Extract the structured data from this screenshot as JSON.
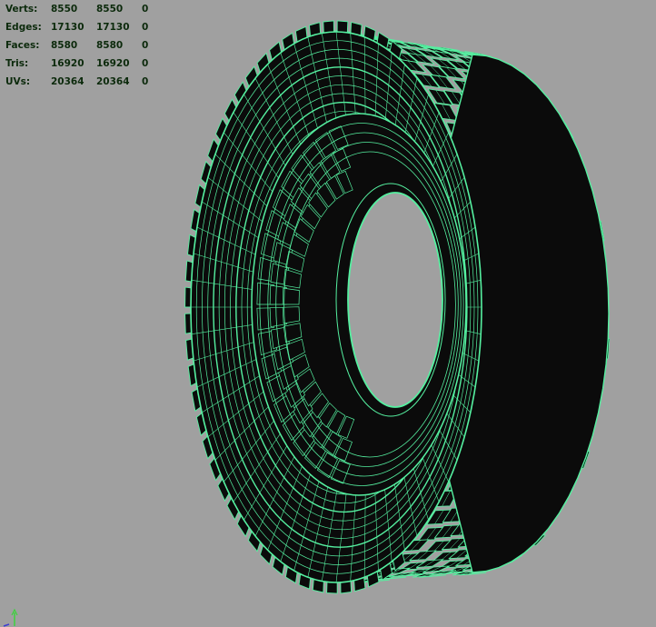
{
  "hud": {
    "rows": [
      {
        "label": "Verts:",
        "v1": "8550",
        "v2": "8550",
        "v3": "0"
      },
      {
        "label": "Edges:",
        "v1": "17130",
        "v2": "17130",
        "v3": "0"
      },
      {
        "label": "Faces:",
        "v1": "8580",
        "v2": "8580",
        "v3": "0"
      },
      {
        "label": "Tris:",
        "v1": "16920",
        "v2": "16920",
        "v3": "0"
      },
      {
        "label": "UVs:",
        "v1": "20364",
        "v2": "20364",
        "v3": "0"
      }
    ]
  },
  "viewport": {
    "background_color": "#a0a0a0",
    "wireframe_color": "#55f0a0",
    "mesh_fill_color": "#0b0b0b",
    "hud_text_color": "#0c2a0c",
    "axis_gizmo": {
      "y_color": "#3cd23c",
      "x_color": "#d23c3c",
      "z_color": "#3c3cd2"
    }
  }
}
